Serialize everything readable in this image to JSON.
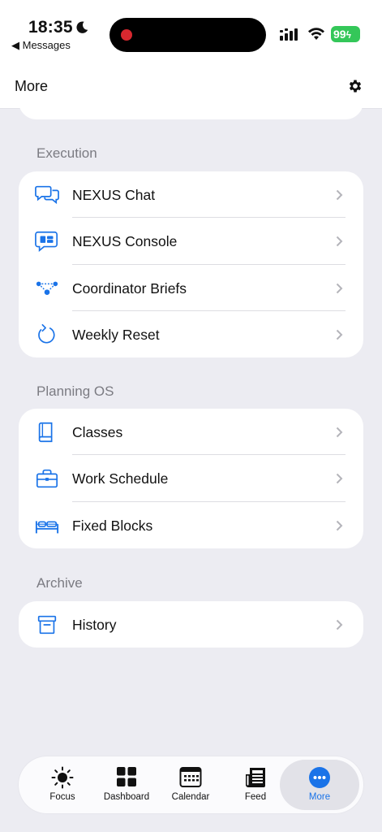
{
  "status_bar": {
    "time": "18:35",
    "back_label": "◀ Messages",
    "battery": "99"
  },
  "header": {
    "title": "More"
  },
  "sections": [
    {
      "title": "Execution",
      "items": [
        {
          "label": "NEXUS Chat",
          "icon": "chat-bubbles-icon"
        },
        {
          "label": "NEXUS Console",
          "icon": "console-bubble-icon"
        },
        {
          "label": "Coordinator Briefs",
          "icon": "network-nodes-icon"
        },
        {
          "label": "Weekly Reset",
          "icon": "refresh-icon"
        }
      ]
    },
    {
      "title": "Planning OS",
      "items": [
        {
          "label": "Classes",
          "icon": "book-icon"
        },
        {
          "label": "Work Schedule",
          "icon": "briefcase-icon"
        },
        {
          "label": "Fixed Blocks",
          "icon": "bed-icon"
        }
      ]
    },
    {
      "title": "Archive",
      "items": [
        {
          "label": "History",
          "icon": "archive-box-icon"
        }
      ]
    }
  ],
  "tabs": [
    {
      "label": "Focus",
      "icon": "sun-icon"
    },
    {
      "label": "Dashboard",
      "icon": "grid-icon"
    },
    {
      "label": "Calendar",
      "icon": "calendar-icon"
    },
    {
      "label": "Feed",
      "icon": "newspaper-icon"
    },
    {
      "label": "More",
      "icon": "more-dots-icon",
      "active": true
    }
  ],
  "colors": {
    "accent": "#1a73e8",
    "background": "#ececf2",
    "battery": "#34c759"
  }
}
